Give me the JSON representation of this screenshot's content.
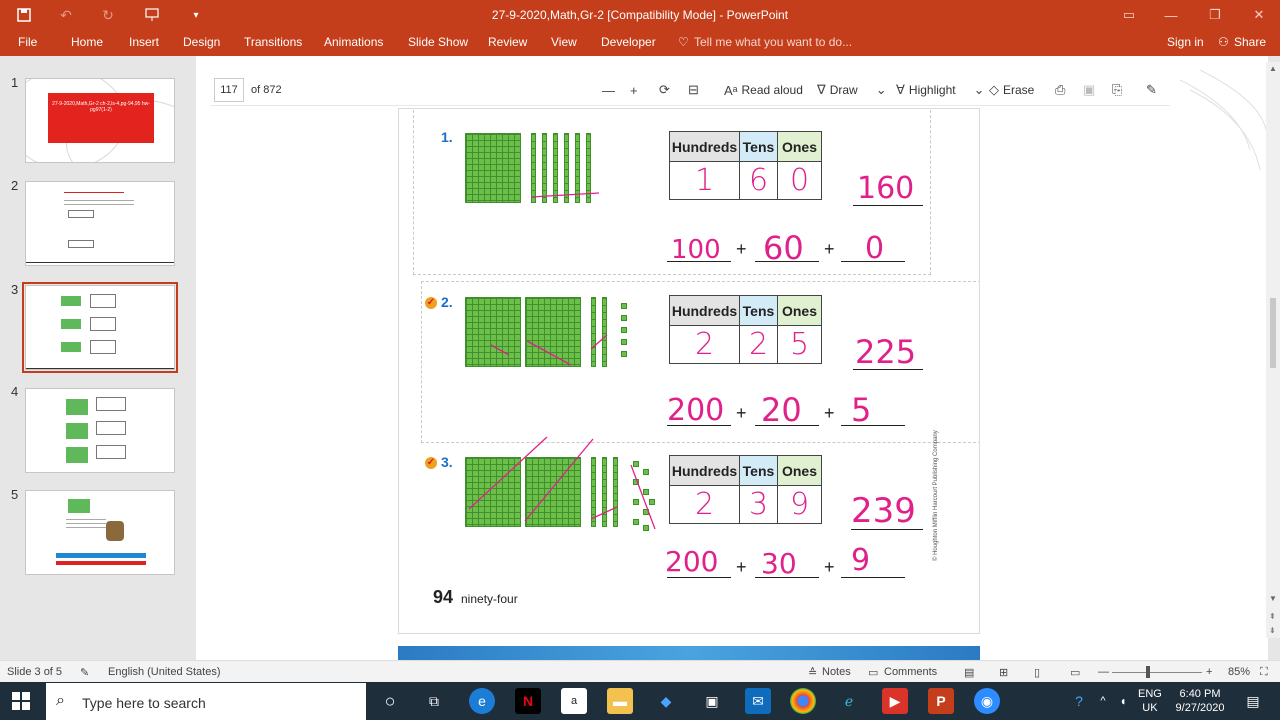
{
  "window": {
    "title": "27-9-2020,Math,Gr-2 [Compatibility Mode] - PowerPoint",
    "brand_color": "#c43e1c"
  },
  "ribbon": {
    "tabs": [
      "File",
      "Home",
      "Insert",
      "Design",
      "Transitions",
      "Animations",
      "Slide Show",
      "Review",
      "View",
      "Developer"
    ],
    "tell_me": "Tell me what you want to do...",
    "sign_in": "Sign in",
    "share": "Share"
  },
  "thumbnails": {
    "numbers": [
      "1",
      "2",
      "3",
      "4",
      "5"
    ],
    "selected": 3,
    "slide1_text": "27-9-2020,Math,Gr-2 ch-2,ls-4,pg-94,95 hw-pg97(1-2)"
  },
  "pdf_toolbar": {
    "page": "117",
    "of_pages": "of 872",
    "read_aloud": "Read aloud",
    "draw": "Draw",
    "highlight": "Highlight",
    "erase": "Erase"
  },
  "worksheet": {
    "headers": [
      "Hundreds",
      "Tens",
      "Ones"
    ],
    "problems": [
      {
        "num": "1.",
        "digits": [
          "1",
          "6",
          "0"
        ],
        "number": "160",
        "expanded": [
          "100",
          "60",
          "0"
        ]
      },
      {
        "num": "2.",
        "digits": [
          "2",
          "2",
          "5"
        ],
        "number": "225",
        "expanded": [
          "200",
          "20",
          "5"
        ]
      },
      {
        "num": "3.",
        "digits": [
          "2",
          "3",
          "9"
        ],
        "number": "239",
        "expanded": [
          "200",
          "30",
          "9"
        ]
      }
    ],
    "page_number": "94",
    "page_word": "ninety-four",
    "copyright": "© Houghton Mifflin Harcourt Publishing Company"
  },
  "status": {
    "slide": "Slide 3 of 5",
    "language": "English (United States)",
    "notes": "Notes",
    "comments": "Comments",
    "zoom": "85%"
  },
  "taskbar": {
    "search_placeholder": "Type here to search",
    "lang": "ENG",
    "region": "UK",
    "time": "6:40 PM",
    "date": "9/27/2020"
  }
}
